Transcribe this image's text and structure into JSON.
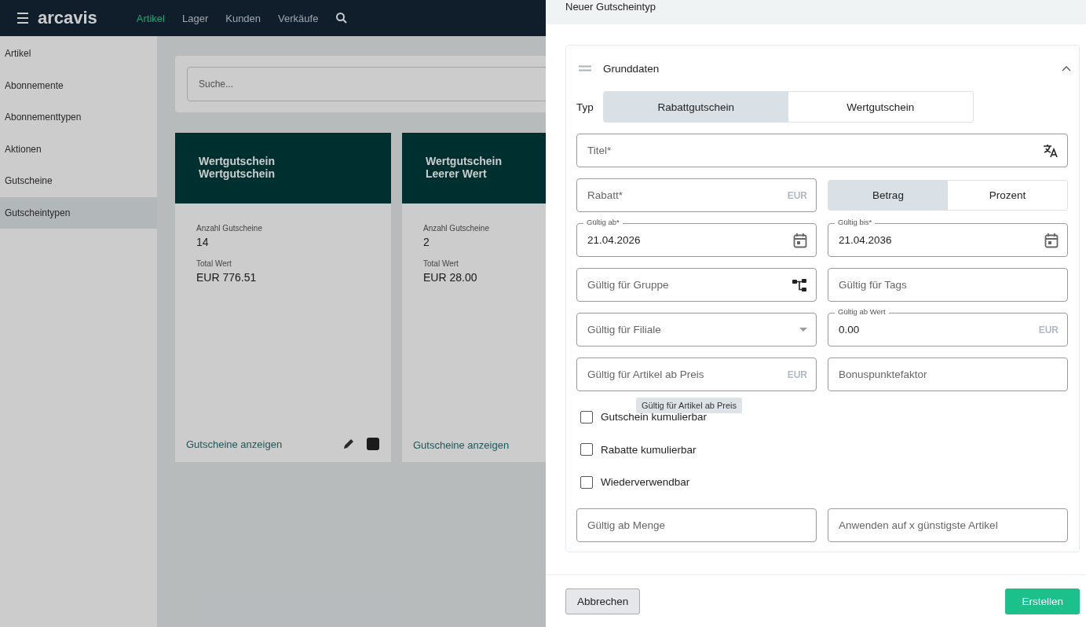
{
  "app": {
    "logo": "arcavis",
    "nav": [
      {
        "label": "Artikel",
        "selected": true
      },
      {
        "label": "Lager",
        "selected": false
      },
      {
        "label": "Kunden",
        "selected": false
      },
      {
        "label": "Verkäufe",
        "selected": false
      }
    ],
    "sidebar": [
      {
        "label": "Artikel",
        "selected": false
      },
      {
        "label": "Abonnemente",
        "selected": false
      },
      {
        "label": "Abonnementtypen",
        "selected": false
      },
      {
        "label": "Aktionen",
        "selected": false
      },
      {
        "label": "Gutscheine",
        "selected": false
      },
      {
        "label": "Gutscheintypen",
        "selected": true
      }
    ],
    "search": {
      "placeholder": "Suche..."
    },
    "cards": [
      {
        "title": [
          "Wertgutschein",
          "Wertgutschein"
        ],
        "count_label": "Anzahl Gutscheine",
        "count": "14",
        "total_label": "Total Wert",
        "total": "EUR 776.51",
        "link": "Gutscheine anzeigen",
        "actions": true
      },
      {
        "title": [
          "Wertgutschein",
          "Leerer Wert"
        ],
        "count_label": "Anzahl Gutscheine",
        "count": "2",
        "total_label": "Total Wert",
        "total": "EUR 28.00",
        "link": "Gutscheine anzeigen",
        "actions": false
      }
    ]
  },
  "dialog": {
    "title": "Neuer Gutscheintyp",
    "section": {
      "title": "Grunddaten",
      "expanded": true,
      "type_label": "Typ",
      "type_options": [
        {
          "label": "Rabattgutschein",
          "selected": true
        },
        {
          "label": "Wertgutschein",
          "selected": false
        }
      ],
      "fields": [
        {
          "kind": "translatable",
          "placeholder": "Titel*"
        },
        {
          "kind": "text",
          "placeholder": "Rabatt*",
          "suffix": "EUR"
        },
        {
          "kind": "segmented",
          "options": [
            {
              "label": "Betrag",
              "selected": true
            },
            {
              "label": "Prozent",
              "selected": false
            }
          ]
        },
        {
          "kind": "date",
          "label": "Gültig ab*",
          "value": "21.04.2026"
        },
        {
          "kind": "date",
          "label": "Gültig bis*",
          "value": "21.04.2036"
        },
        {
          "kind": "group-picker",
          "placeholder": "Gültig für Gruppe"
        },
        {
          "kind": "text",
          "placeholder": "Gültig für Tags"
        },
        {
          "kind": "select",
          "placeholder": "Gültig für Filiale"
        },
        {
          "kind": "text",
          "label": "Gültig ab Wert",
          "value": "0.00",
          "suffix": "EUR"
        },
        {
          "kind": "text",
          "placeholder": "Gültig für Artikel ab Preis",
          "suffix": "EUR",
          "tooltip": "Gültig für Artikel ab Preis"
        },
        {
          "kind": "text",
          "placeholder": "Bonuspunktefaktor"
        }
      ],
      "checkboxes": [
        {
          "label": "Gutschein kumulierbar",
          "checked": false
        },
        {
          "label": "Rabatte kumulierbar",
          "checked": false
        },
        {
          "label": "Wiederverwendbar",
          "checked": false
        }
      ],
      "bottom_fields": [
        {
          "kind": "text",
          "placeholder": "Gültig ab Menge"
        },
        {
          "kind": "text",
          "placeholder": "Anwenden auf x günstigste Artikel"
        }
      ]
    },
    "buttons": [
      {
        "label": "Abbrechen",
        "kind": "secondary"
      },
      {
        "label": "Erstellen",
        "kind": "primary"
      }
    ]
  }
}
